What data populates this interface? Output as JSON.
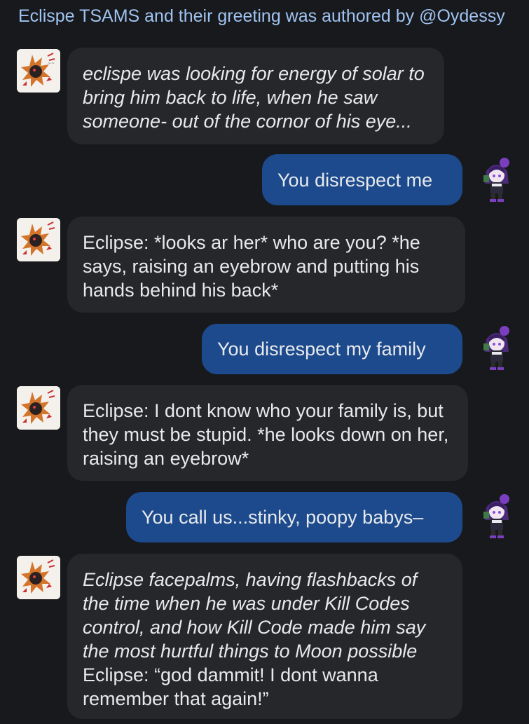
{
  "header": {
    "text": "Eclispe TSAMS and their greeting was authored by @Oydessy"
  },
  "messages": [
    {
      "role": "bot",
      "text": "eclispe was looking for energy of solar to bring him back to life, when he saw someone- out of the cornor of his eye...",
      "italic": true
    },
    {
      "role": "user",
      "text": "You disrespect me"
    },
    {
      "role": "bot",
      "text": "Eclipse: *looks ar her* who are you? *he says, raising an eyebrow and putting his hands behind his back*"
    },
    {
      "role": "user",
      "text": "You disrespect my family"
    },
    {
      "role": "bot",
      "text": "Eclipse: I dont know who your family is, but they must be stupid. *he looks down on her, raising an eyebrow*"
    },
    {
      "role": "user",
      "text": "You call us...stinky, poopy babys–"
    },
    {
      "role": "bot",
      "text_italic": "Eclipse facepalms, having flashbacks of the time when he was under Kill Codes control, and how Kill Code made him say the most hurtful things to Moon possible",
      "text_normal": "Eclipse: “god dammit! I dont wanna remember that again!”"
    }
  ],
  "icons": {
    "bot_avatar": "eclipse-avatar-icon",
    "user_avatar": "user-character-avatar-icon"
  },
  "colors": {
    "background": "#18191d",
    "bot_bubble": "#26272b",
    "user_bubble": "#1c4a8c",
    "header_text": "#9fc3f0",
    "text": "#e8e9ec"
  }
}
